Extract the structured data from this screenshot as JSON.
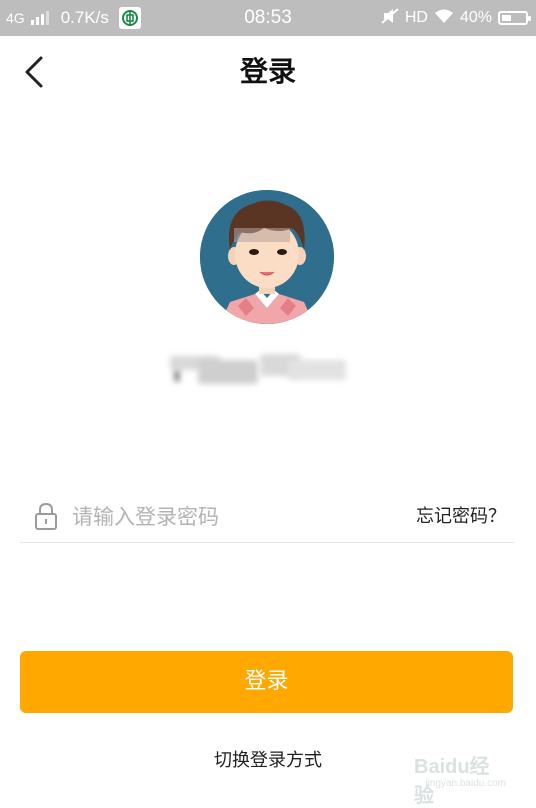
{
  "status_bar": {
    "network": "4G",
    "speed": "0.7K/s",
    "time": "08:53",
    "hd": "HD",
    "battery": "40%",
    "battery_level": 0.4,
    "app_icon": "bank-app-icon"
  },
  "header": {
    "title": "登录",
    "back_icon": "chevron-left-icon"
  },
  "profile": {
    "avatar_icon": "cartoon-avatar-icon",
    "username": ""
  },
  "password": {
    "placeholder": "请输入登录密码",
    "forgot_label": "忘记密码？",
    "lock_icon": "lock-icon"
  },
  "actions": {
    "login_label": "登录",
    "switch_label": "切换登录方式"
  },
  "watermark": {
    "brand": "Baidu经验",
    "url": "jingyan.baidu.com"
  },
  "colors": {
    "accent": "#fea800",
    "status_bar": "#bdbdbd"
  }
}
